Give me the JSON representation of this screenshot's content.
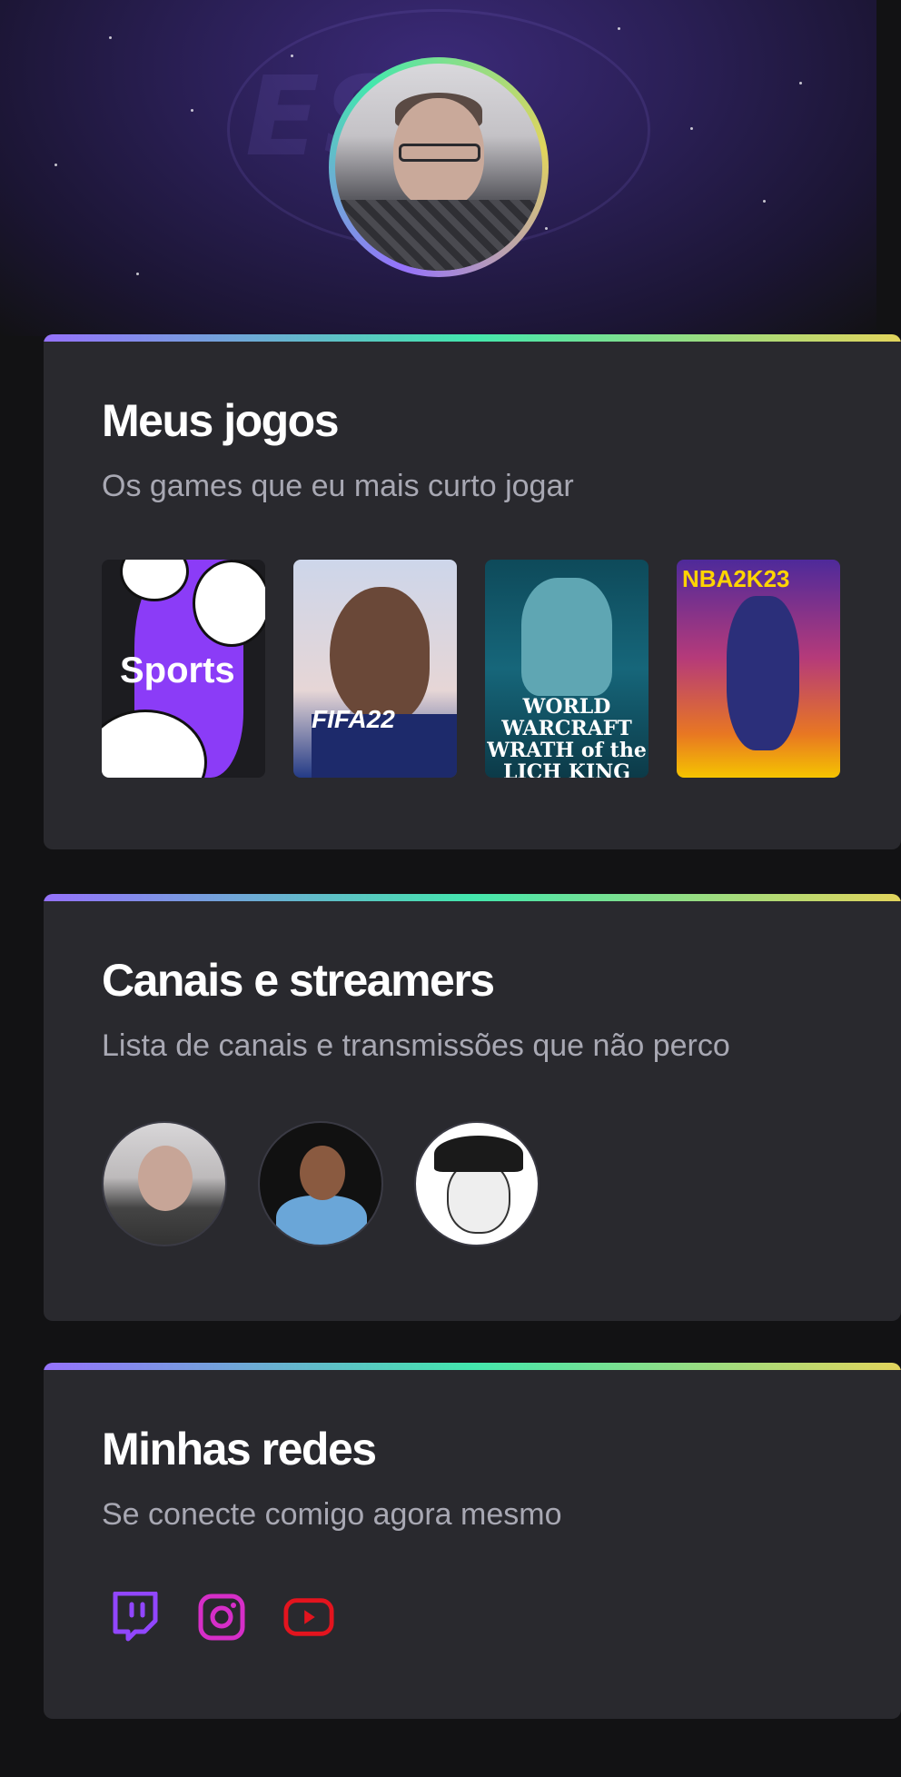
{
  "profile": {
    "avatar_alt": "Foto de perfil"
  },
  "games_section": {
    "title": "Meus jogos",
    "subtitle": "Os games que eu mais curto jogar",
    "games": [
      {
        "name": "Sports",
        "label": "Sports"
      },
      {
        "name": "FIFA 22",
        "label": "FIFA22"
      },
      {
        "name": "World of Warcraft: Wrath of the Lich King Classic",
        "label": "WORLD WARCRAFT WRATH of the LICH KING CLASSIC"
      },
      {
        "name": "NBA 2K23",
        "label": "NBA2K23"
      }
    ]
  },
  "channels_section": {
    "title": "Canais e streamers",
    "subtitle": "Lista de canais e transmissões que não perco",
    "channels": [
      {
        "avatar": "streamer-1"
      },
      {
        "avatar": "streamer-2"
      },
      {
        "avatar": "streamer-3"
      }
    ]
  },
  "social_section": {
    "title": "Minhas redes",
    "subtitle": "Se conecte comigo agora mesmo",
    "links": [
      {
        "icon": "twitch-icon",
        "color": "#9146FF"
      },
      {
        "icon": "instagram-icon",
        "color": "#D62EC8"
      },
      {
        "icon": "youtube-icon",
        "color": "#E3141E"
      }
    ]
  },
  "colors": {
    "background": "#121214",
    "card": "#29292E",
    "gradient": [
      "#9572FC",
      "#43E7AD",
      "#E2D45C"
    ]
  }
}
